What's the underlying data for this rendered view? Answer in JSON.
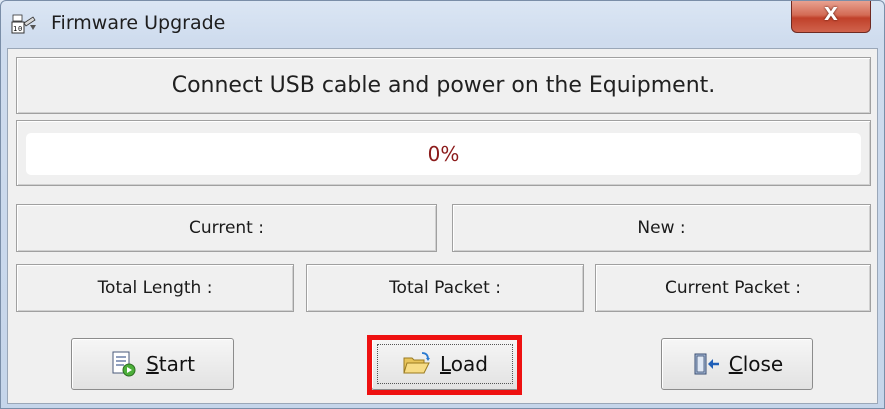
{
  "window": {
    "title": "Firmware Upgrade",
    "close_glyph": "X",
    "app_icon": "firmware-app-icon"
  },
  "message": "Connect USB cable and power on the Equipment.",
  "progress": {
    "value": 0,
    "label": "0%",
    "text_color": "#8b1a1a"
  },
  "info": {
    "current": "Current :",
    "new": "New :",
    "total_length": "Total Length :",
    "total_packet": "Total Packet :",
    "current_packet": "Current Packet :"
  },
  "buttons": {
    "start": {
      "mnemonic": "S",
      "rest": "tart",
      "icon": "document-start-icon"
    },
    "load": {
      "mnemonic": "L",
      "rest": "oad",
      "icon": "folder-open-icon"
    },
    "close": {
      "mnemonic": "C",
      "rest": "lose",
      "icon": "exit-door-icon"
    }
  },
  "highlight_color": "#ee1111"
}
